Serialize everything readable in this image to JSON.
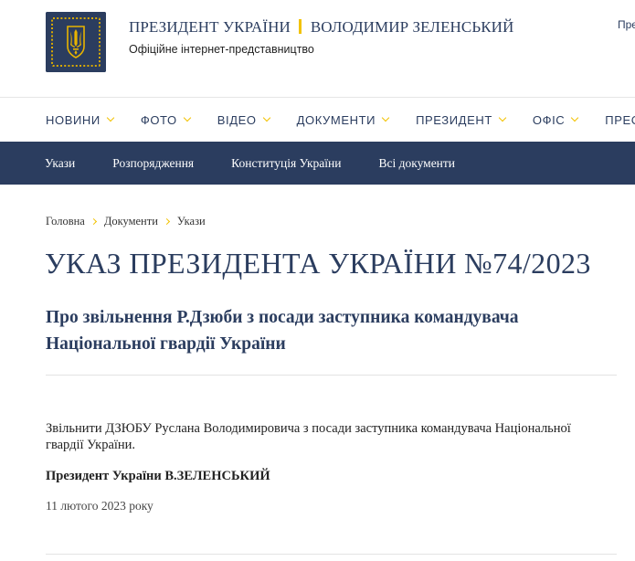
{
  "header": {
    "title_part1": "ПРЕЗИДЕНТ УКРАЇНИ",
    "title_part2": "ВОЛОДИМИР ЗЕЛЕНСЬКИЙ",
    "subtitle": "Офіційне інтернет-представництво",
    "top_link": "През"
  },
  "main_nav": {
    "items": [
      {
        "label": "НОВИНИ"
      },
      {
        "label": "ФОТО"
      },
      {
        "label": "ВІДЕО"
      },
      {
        "label": "ДОКУМЕНТИ"
      },
      {
        "label": "ПРЕЗИДЕНТ"
      },
      {
        "label": "ОФІС"
      },
      {
        "label": "ПРЕС"
      }
    ]
  },
  "sub_nav": {
    "items": [
      {
        "label": "Укази"
      },
      {
        "label": "Розпорядження"
      },
      {
        "label": "Конституція України"
      },
      {
        "label": "Всі документи"
      }
    ]
  },
  "breadcrumb": [
    "Головна",
    "Документи",
    "Укази"
  ],
  "document": {
    "title": "УКАЗ ПРЕЗИДЕНТА УКРАЇНИ №74/2023",
    "subtitle": "Про звільнення Р.Дзюби з посади заступника командувача Національної гвардії України",
    "body": "Звільнити ДЗЮБУ Руслана Володимировича з посади заступника командувача Національної гвардії України.",
    "signature": "Президент України В.ЗЕЛЕНСЬКИЙ",
    "date": "11 лютого 2023 року"
  },
  "colors": {
    "navy": "#2b3d5f",
    "accent_yellow": "#f2c200"
  },
  "icons": {
    "logo": "trident-emblem-icon",
    "nav_chevron": "chevron-down-icon",
    "breadcrumb_separator": "chevron-right-icon"
  }
}
